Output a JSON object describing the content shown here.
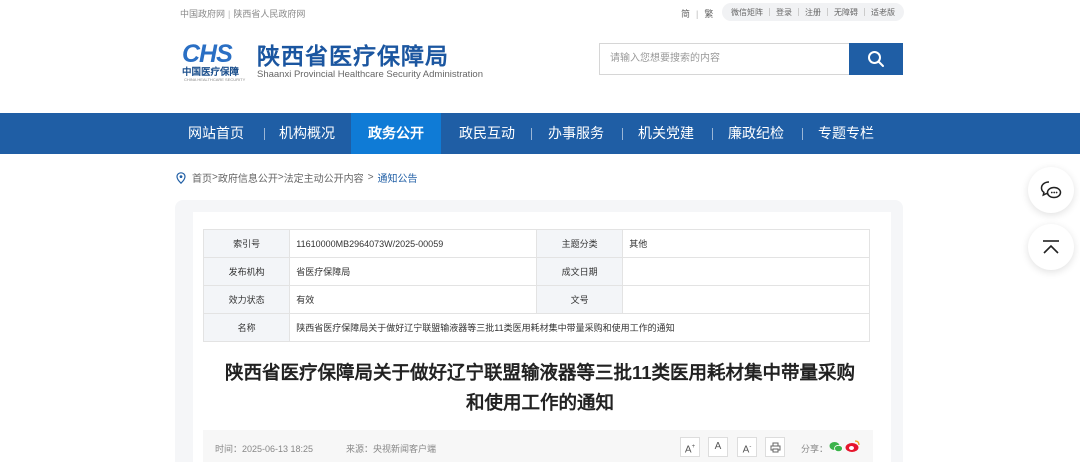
{
  "topbar": {
    "links": [
      "中国政府网",
      "陕西省人民政府网"
    ],
    "link_sep": "|",
    "lang": [
      "简",
      "繁"
    ],
    "tools": [
      "微信矩阵",
      "登录",
      "注册",
      "无障碍",
      "适老版"
    ]
  },
  "header": {
    "logo_mark": "CHS",
    "logo_cn": "中国医疗保障",
    "logo_en": "CHINA HEALTHCARE SECURITY",
    "site_name": "陕西省医疗保障局",
    "site_en": "Shaanxi Provincial Healthcare Security Administration",
    "search_placeholder": "请输入您想要搜索的内容"
  },
  "nav": {
    "items": [
      "网站首页",
      "机构概况",
      "政务公开",
      "政民互动",
      "办事服务",
      "机关党建",
      "廉政纪检",
      "专题专栏"
    ],
    "active": "政务公开"
  },
  "breadcrumb": {
    "items": [
      "首页",
      "政府信息公开",
      "法定主动公开内容"
    ],
    "sep": ">",
    "current": "通知公告"
  },
  "meta": {
    "index_label": "索引号",
    "index_value": "11610000MB2964073W/2025-00059",
    "topic_label": "主题分类",
    "topic_value": "其他",
    "publisher_label": "发布机构",
    "publisher_value": "省医疗保障局",
    "date_label": "成文日期",
    "date_value": "",
    "status_label": "效力状态",
    "status_value": "有效",
    "docno_label": "文号",
    "docno_value": "",
    "name_label": "名称",
    "name_value": "陕西省医疗保障局关于做好辽宁联盟输液器等三批11类医用耗材集中带量采购和使用工作的通知"
  },
  "article": {
    "title_line1": "陕西省医疗保障局关于做好辽宁联盟输液器等三批11类医用耗材集中带量采购",
    "title_line2": "和使用工作的通知",
    "time": "时间：2025-06-13 18:25",
    "source": "来源：央视新闻客户端",
    "font_large": "A",
    "font_medium": "A",
    "font_small": "A",
    "share_label": "分享："
  },
  "colors": {
    "brand": "#1f5ea5",
    "nav_active": "#0f7bd6",
    "wechat": "#3bb34a",
    "weibo": "#e6162d"
  }
}
